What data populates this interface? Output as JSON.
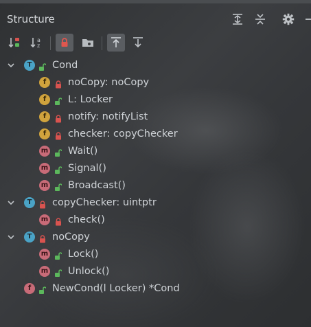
{
  "panel": {
    "title": "Structure"
  },
  "tree": [
    {
      "kind": "T",
      "label": "Cond",
      "lock": "open"
    },
    {
      "kind": "f",
      "label": "noCopy: noCopy",
      "lock": "closed"
    },
    {
      "kind": "f",
      "label": "L: Locker",
      "lock": "open"
    },
    {
      "kind": "f",
      "label": "notify: notifyList",
      "lock": "closed"
    },
    {
      "kind": "f",
      "label": "checker: copyChecker",
      "lock": "closed"
    },
    {
      "kind": "m",
      "label": "Wait()",
      "lock": "open"
    },
    {
      "kind": "m",
      "label": "Signal()",
      "lock": "open"
    },
    {
      "kind": "m",
      "label": "Broadcast()",
      "lock": "open"
    },
    {
      "kind": "T",
      "label": "copyChecker: uintptr",
      "lock": "closed"
    },
    {
      "kind": "m",
      "label": "check()",
      "lock": "closed"
    },
    {
      "kind": "T",
      "label": "noCopy",
      "lock": "closed"
    },
    {
      "kind": "m",
      "label": "Lock()",
      "lock": "open"
    },
    {
      "kind": "m",
      "label": "Unlock()",
      "lock": "open"
    },
    {
      "kind": "f",
      "label": "NewCond(l Locker) *Cond",
      "lock": "open"
    }
  ],
  "colors": {
    "type_badge": "#4aa3c6",
    "field_badge": "#d0a33d",
    "method_badge": "#c86b78",
    "lock_closed": "#d9534f",
    "lock_open": "#5cb85c"
  }
}
